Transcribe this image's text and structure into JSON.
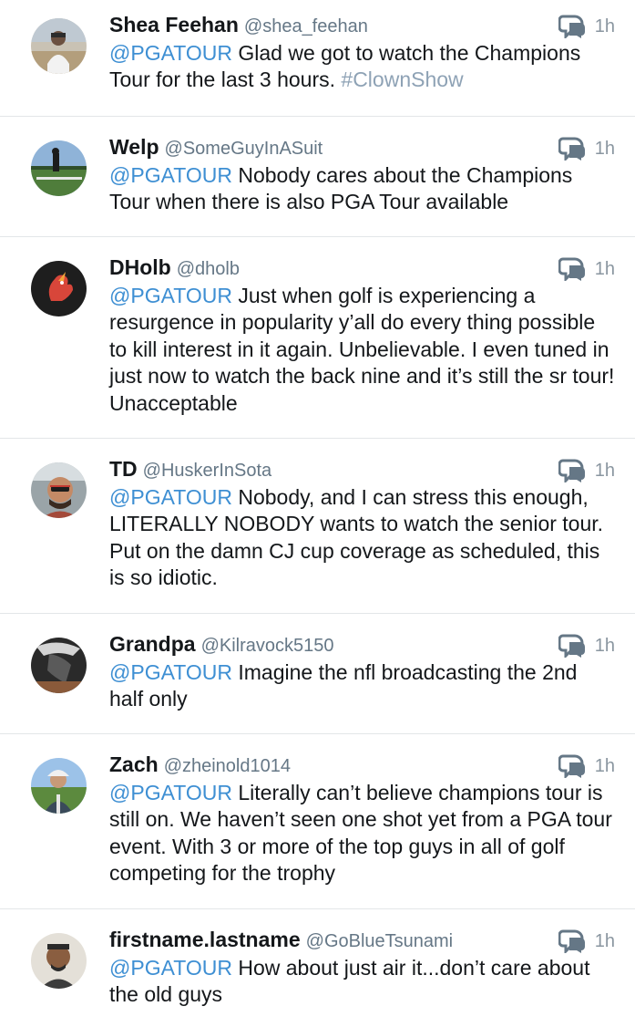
{
  "tweets": [
    {
      "name": "Shea Feehan",
      "handle": "@shea_feehan",
      "time": "1h",
      "mention": "@PGATOUR",
      "text": "Glad we got to watch the Champions Tour for the last 3 hours.",
      "hashtag": "#ClownShow",
      "avatar": "person-outdoors-avatar"
    },
    {
      "name": "Welp",
      "handle": "@SomeGuyInASuit",
      "time": "1h",
      "mention": "@PGATOUR",
      "text": "Nobody cares about the Champions Tour when there is also PGA Tour available",
      "avatar": "golf-course-avatar"
    },
    {
      "name": "DHolb",
      "handle": "@dholb",
      "time": "1h",
      "mention": "@PGATOUR",
      "text": "Just when golf is experiencing a resurgence in popularity y’all do every thing possible to kill interest in it again.  Unbelievable.  I even tuned in just now to watch the back nine and it’s still the sr tour!  Unacceptable",
      "avatar": "rooster-logo-avatar"
    },
    {
      "name": "TD",
      "handle": "@HuskerInSota",
      "time": "1h",
      "mention": "@PGATOUR",
      "text": "Nobody, and I can stress this enough, LITERALLY NOBODY wants to watch the senior tour. Put on the damn CJ cup coverage as scheduled, this is so idiotic.",
      "avatar": "man-sunglasses-avatar"
    },
    {
      "name": "Grandpa",
      "handle": "@Kilravock5150",
      "time": "1h",
      "mention": "@PGATOUR",
      "text": "Imagine the nfl broadcasting the 2nd half only",
      "avatar": "dark-object-avatar"
    },
    {
      "name": "Zach",
      "handle": "@zheinold1014",
      "time": "1h",
      "mention": "@PGATOUR",
      "text": "Literally can’t believe champions tour is still on. We haven’t seen one shot yet from a PGA tour event. With 3 or more of the top guys in all of golf competing for the trophy",
      "avatar": "man-cap-golf-avatar"
    },
    {
      "name": "firstname.lastname",
      "handle": "@GoBlueTsunami",
      "time": "1h",
      "mention": "@PGATOUR",
      "text": "How about just air it...don’t care about the old guys",
      "avatar": "man-portrait-avatar"
    }
  ]
}
